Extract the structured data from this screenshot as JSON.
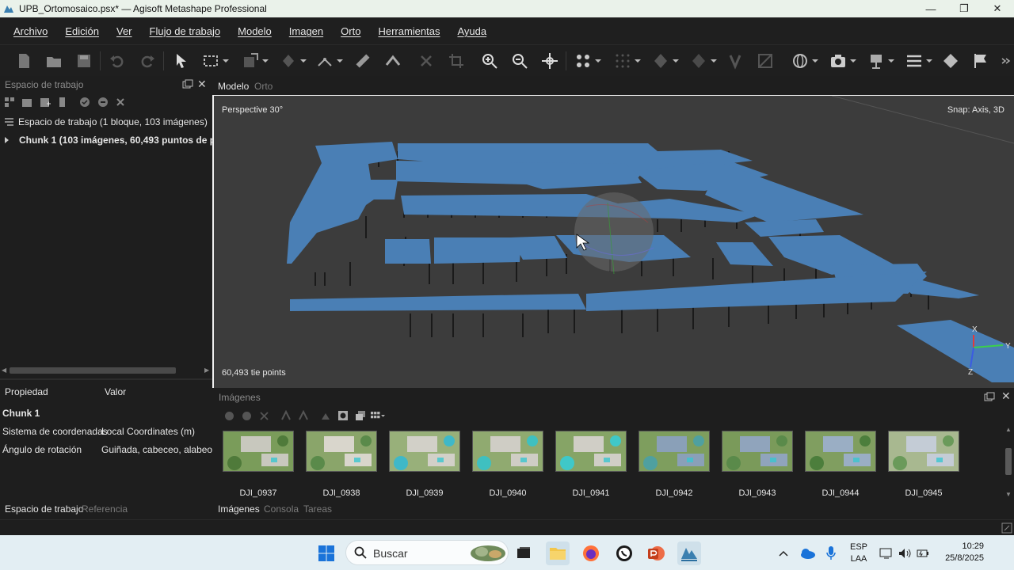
{
  "window": {
    "title": "UPB_Ortomosaico.psx* — Agisoft Metashape Professional",
    "minimize": "—",
    "maximize": "❐",
    "close": "✕"
  },
  "menu": [
    "Archivo",
    "Edición",
    "Ver",
    "Flujo de trabajo",
    "Modelo",
    "Imagen",
    "Orto",
    "Herramientas",
    "Ayuda"
  ],
  "workspace": {
    "title": "Espacio de trabajo",
    "root": "Espacio de trabajo (1 bloque, 103 imágenes)",
    "chunk": "Chunk 1 (103 imágenes, 60,493 puntos de p"
  },
  "properties": {
    "col_property": "Propiedad",
    "col_value": "Valor",
    "chunk_name": "Chunk 1",
    "rows": [
      {
        "name": "Sistema de coordenadas",
        "value": "Local Coordinates (m)"
      },
      {
        "name": "Ángulo de rotación",
        "value": "Guiñada, cabeceo, alabeo"
      }
    ]
  },
  "left_tabs": {
    "active": "Espacio de trabajo",
    "other": "Referencia"
  },
  "viewport": {
    "tab_model": "Modelo",
    "tab_ortho": "Orto",
    "perspective": "Perspective 30°",
    "snap": "Snap: Axis, 3D",
    "tie_points": "60,493 tie points",
    "axis_x": "X",
    "axis_y": "Y",
    "axis_z": "Z",
    "plane_color": "#4a7fb5"
  },
  "images_panel": {
    "title": "Imágenes",
    "thumbnails": [
      "DJI_0937",
      "DJI_0938",
      "DJI_0939",
      "DJI_0940",
      "DJI_0941",
      "DJI_0942",
      "DJI_0943",
      "DJI_0944",
      "DJI_0945"
    ]
  },
  "bottom_tabs": {
    "active": "Imágenes",
    "console": "Consola",
    "tasks": "Tareas"
  },
  "taskbar": {
    "search_placeholder": "Buscar",
    "lang_top": "ESP",
    "lang_bottom": "LAA",
    "time": "10:29",
    "date": "25/8/2025"
  }
}
